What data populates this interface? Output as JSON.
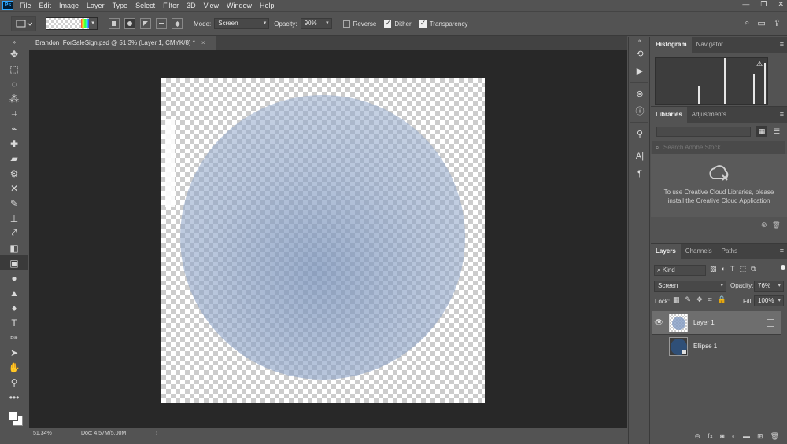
{
  "app": {
    "logo": "Ps"
  },
  "menu": [
    "File",
    "Edit",
    "Image",
    "Layer",
    "Type",
    "Select",
    "Filter",
    "3D",
    "View",
    "Window",
    "Help"
  ],
  "window_controls": [
    "—",
    "❐",
    "✕"
  ],
  "options": {
    "mode_label": "Mode:",
    "mode_value": "Screen",
    "opacity_label": "Opacity:",
    "opacity_value": "90%",
    "reverse_label": "Reverse",
    "dither_label": "Dither",
    "transparency_label": "Transparency",
    "reverse_checked": false,
    "dither_checked": true,
    "transparency_checked": true
  },
  "document": {
    "tab_title": "Brandon_ForSaleSign.psd @ 51.3% (Layer 1, CMYK/8) *",
    "close_glyph": "×",
    "zoom": "51.34%",
    "doc_size": "Doc: 4.57M/5.00M",
    "status_arrow": "›"
  },
  "panels": {
    "histogram_tab": "Histogram",
    "navigator_tab": "Navigator",
    "libraries_tab": "Libraries",
    "adjustments_tab": "Adjustments",
    "library_search_placeholder": "Search Adobe Stock",
    "library_message": "To use Creative Cloud Libraries, please install the Creative Cloud Application",
    "layers_tab": "Layers",
    "channels_tab": "Channels",
    "paths_tab": "Paths",
    "filter_kind": "Kind",
    "blend_mode": "Screen",
    "opacity_label": "Opacity:",
    "opacity_value": "76%",
    "lock_label": "Lock:",
    "fill_label": "Fill:",
    "fill_value": "100%"
  },
  "layers": [
    {
      "name": "Layer 1",
      "visible": true,
      "selected": true
    },
    {
      "name": "Ellipse 1",
      "visible": false,
      "selected": false
    }
  ],
  "colors": {
    "ellipse": "#8ca2c6",
    "shape_thumb": "#2f4f77",
    "canvas_bg": "#282828",
    "ui_bg": "#535353"
  }
}
